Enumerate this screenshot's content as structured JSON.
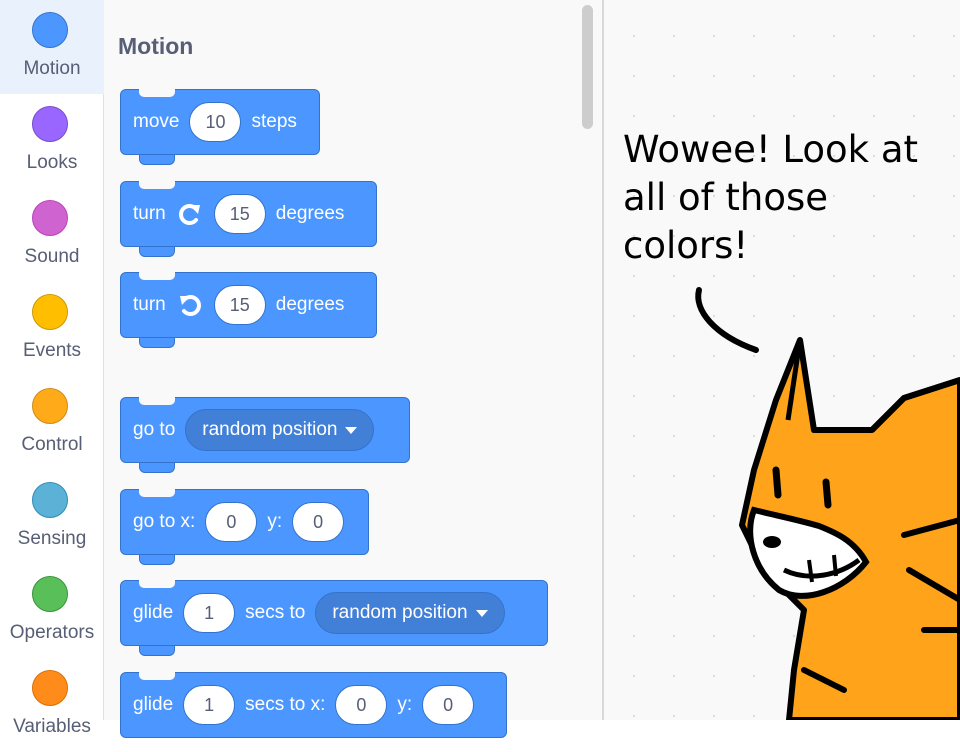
{
  "categories": [
    {
      "label": "Motion",
      "color": "#4c97ff",
      "border": "#3373cc",
      "selected": true
    },
    {
      "label": "Looks",
      "color": "#9966ff",
      "border": "#774dcb"
    },
    {
      "label": "Sound",
      "color": "#cf63cf",
      "border": "#bd42bd"
    },
    {
      "label": "Events",
      "color": "#ffbf00",
      "border": "#cc9900"
    },
    {
      "label": "Control",
      "color": "#ffab19",
      "border": "#cf8b17"
    },
    {
      "label": "Sensing",
      "color": "#5cb1d6",
      "border": "#2e8eb8"
    },
    {
      "label": "Operators",
      "color": "#59c059",
      "border": "#389438"
    },
    {
      "label": "Variables",
      "color": "#ff8c1a",
      "border": "#db6e00"
    }
  ],
  "flyout": {
    "heading": "Motion",
    "blocks": {
      "move": {
        "word": "move",
        "value": "10",
        "suffix": "steps"
      },
      "turn_right": {
        "word": "turn",
        "value": "15",
        "suffix": "degrees",
        "icon": "rotate-right-icon"
      },
      "turn_left": {
        "word": "turn",
        "value": "15",
        "suffix": "degrees",
        "icon": "rotate-left-icon"
      },
      "goto": {
        "word": "go to",
        "dropdown": "random position"
      },
      "goto_xy": {
        "word": "go to x:",
        "x": "0",
        "ylabel": "y:",
        "y": "0"
      },
      "glide_to": {
        "word": "glide",
        "secs": "1",
        "mid": "secs to",
        "dropdown": "random position"
      },
      "glide_xy": {
        "word": "glide",
        "secs": "1",
        "mid": "secs to x:",
        "x": "0",
        "ylabel": "y:",
        "y": "0"
      }
    }
  },
  "speech": {
    "lines": [
      "Wowee! Look at",
      "all of those",
      "colors!"
    ]
  },
  "drawing": {
    "subject": "orange-cat-character",
    "fill": "#ffa31a"
  }
}
